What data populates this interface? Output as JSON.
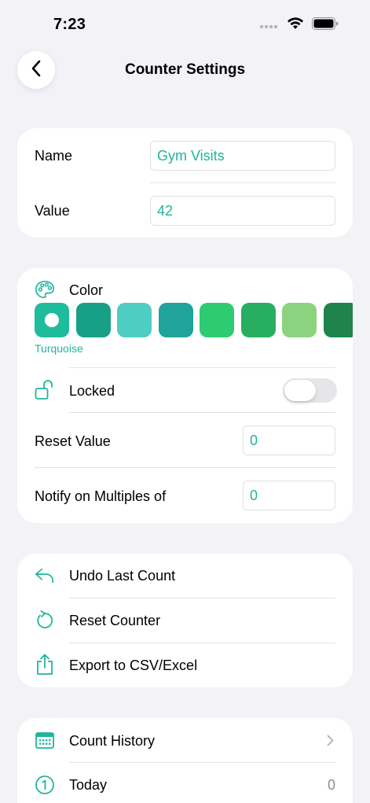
{
  "status": {
    "time": "7:23"
  },
  "nav": {
    "title": "Counter Settings"
  },
  "basic": {
    "name_label": "Name",
    "name_value": "Gym Visits",
    "value_label": "Value",
    "value_value": "42"
  },
  "appearance": {
    "color_label": "Color",
    "selected_color_name": "Turquoise",
    "swatches": [
      "#1fbc9c",
      "#179f87",
      "#4ecdc4",
      "#1fa39b",
      "#2ecc71",
      "#27ae60",
      "#8bd37e",
      "#1e8449"
    ],
    "locked_label": "Locked",
    "locked": false,
    "reset_value_label": "Reset Value",
    "reset_value": "0",
    "notify_label": "Notify on Multiples of",
    "notify_value": "0"
  },
  "actions": {
    "undo_label": "Undo Last Count",
    "reset_label": "Reset Counter",
    "export_label": "Export to CSV/Excel"
  },
  "history": {
    "count_history_label": "Count History",
    "today_label": "Today",
    "today_value": "0"
  },
  "colors": {
    "accent": "#1fb59c",
    "background": "#f2f2f7"
  }
}
